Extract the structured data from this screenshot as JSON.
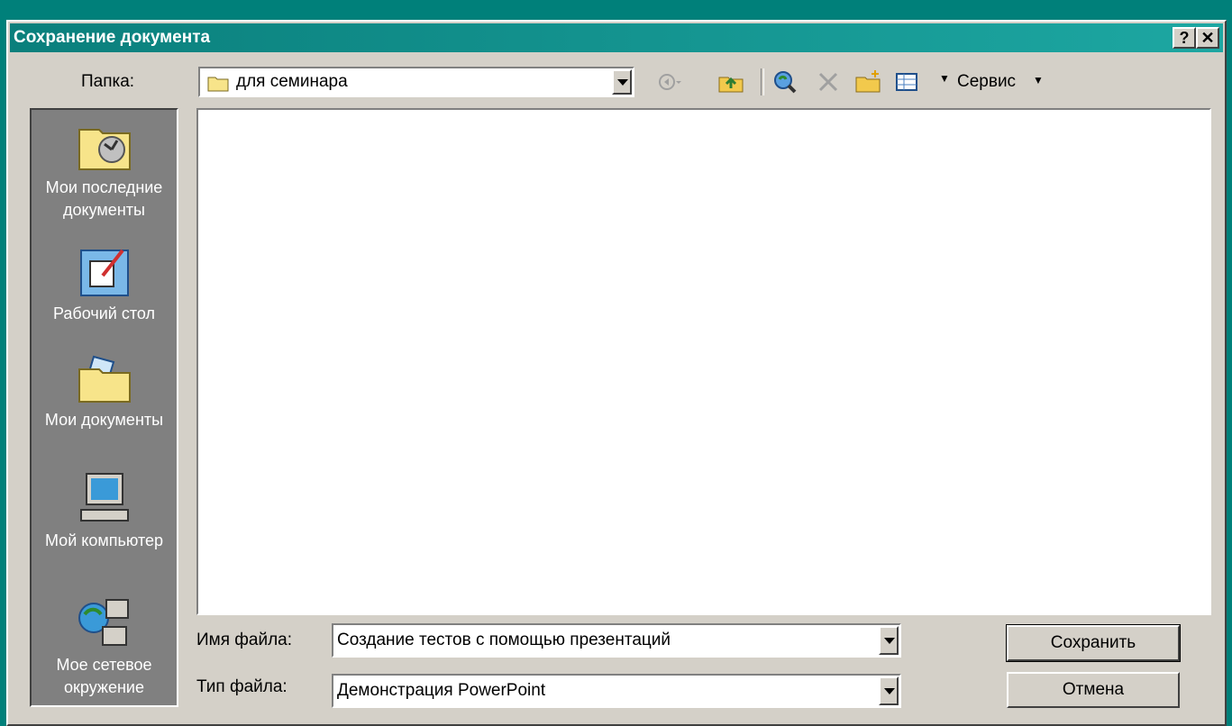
{
  "window": {
    "title": "Сохранение документа",
    "help_label": "?",
    "close_label": "✕"
  },
  "toolbar": {
    "folder_label": "Папка:",
    "folder_value": "для семинара",
    "tools_label": "Сервис",
    "icons": [
      "back-icon",
      "up-folder-icon",
      "search-web-icon",
      "delete-icon",
      "new-folder-icon",
      "views-icon"
    ]
  },
  "places": [
    {
      "label": "Мои последние документы",
      "icon": "recent-documents-icon"
    },
    {
      "label": "Рабочий стол",
      "icon": "desktop-icon"
    },
    {
      "label": "Мои документы",
      "icon": "my-documents-icon"
    },
    {
      "label": "Мой компьютер",
      "icon": "my-computer-icon"
    },
    {
      "label": "Мое сетевое окружение",
      "icon": "network-places-icon"
    }
  ],
  "form": {
    "filename_label": "Имя файла:",
    "filename_value": "Создание тестов с помощью презентаций",
    "filetype_label": "Тип файла:",
    "filetype_value": "Демонстрация PowerPoint"
  },
  "buttons": {
    "save": "Сохранить",
    "cancel": "Отмена"
  },
  "colors": {
    "titlebar": "#0a7f7c",
    "face": "#d4d0c8",
    "places_bg": "#808080",
    "background": "#fdfbd0"
  }
}
